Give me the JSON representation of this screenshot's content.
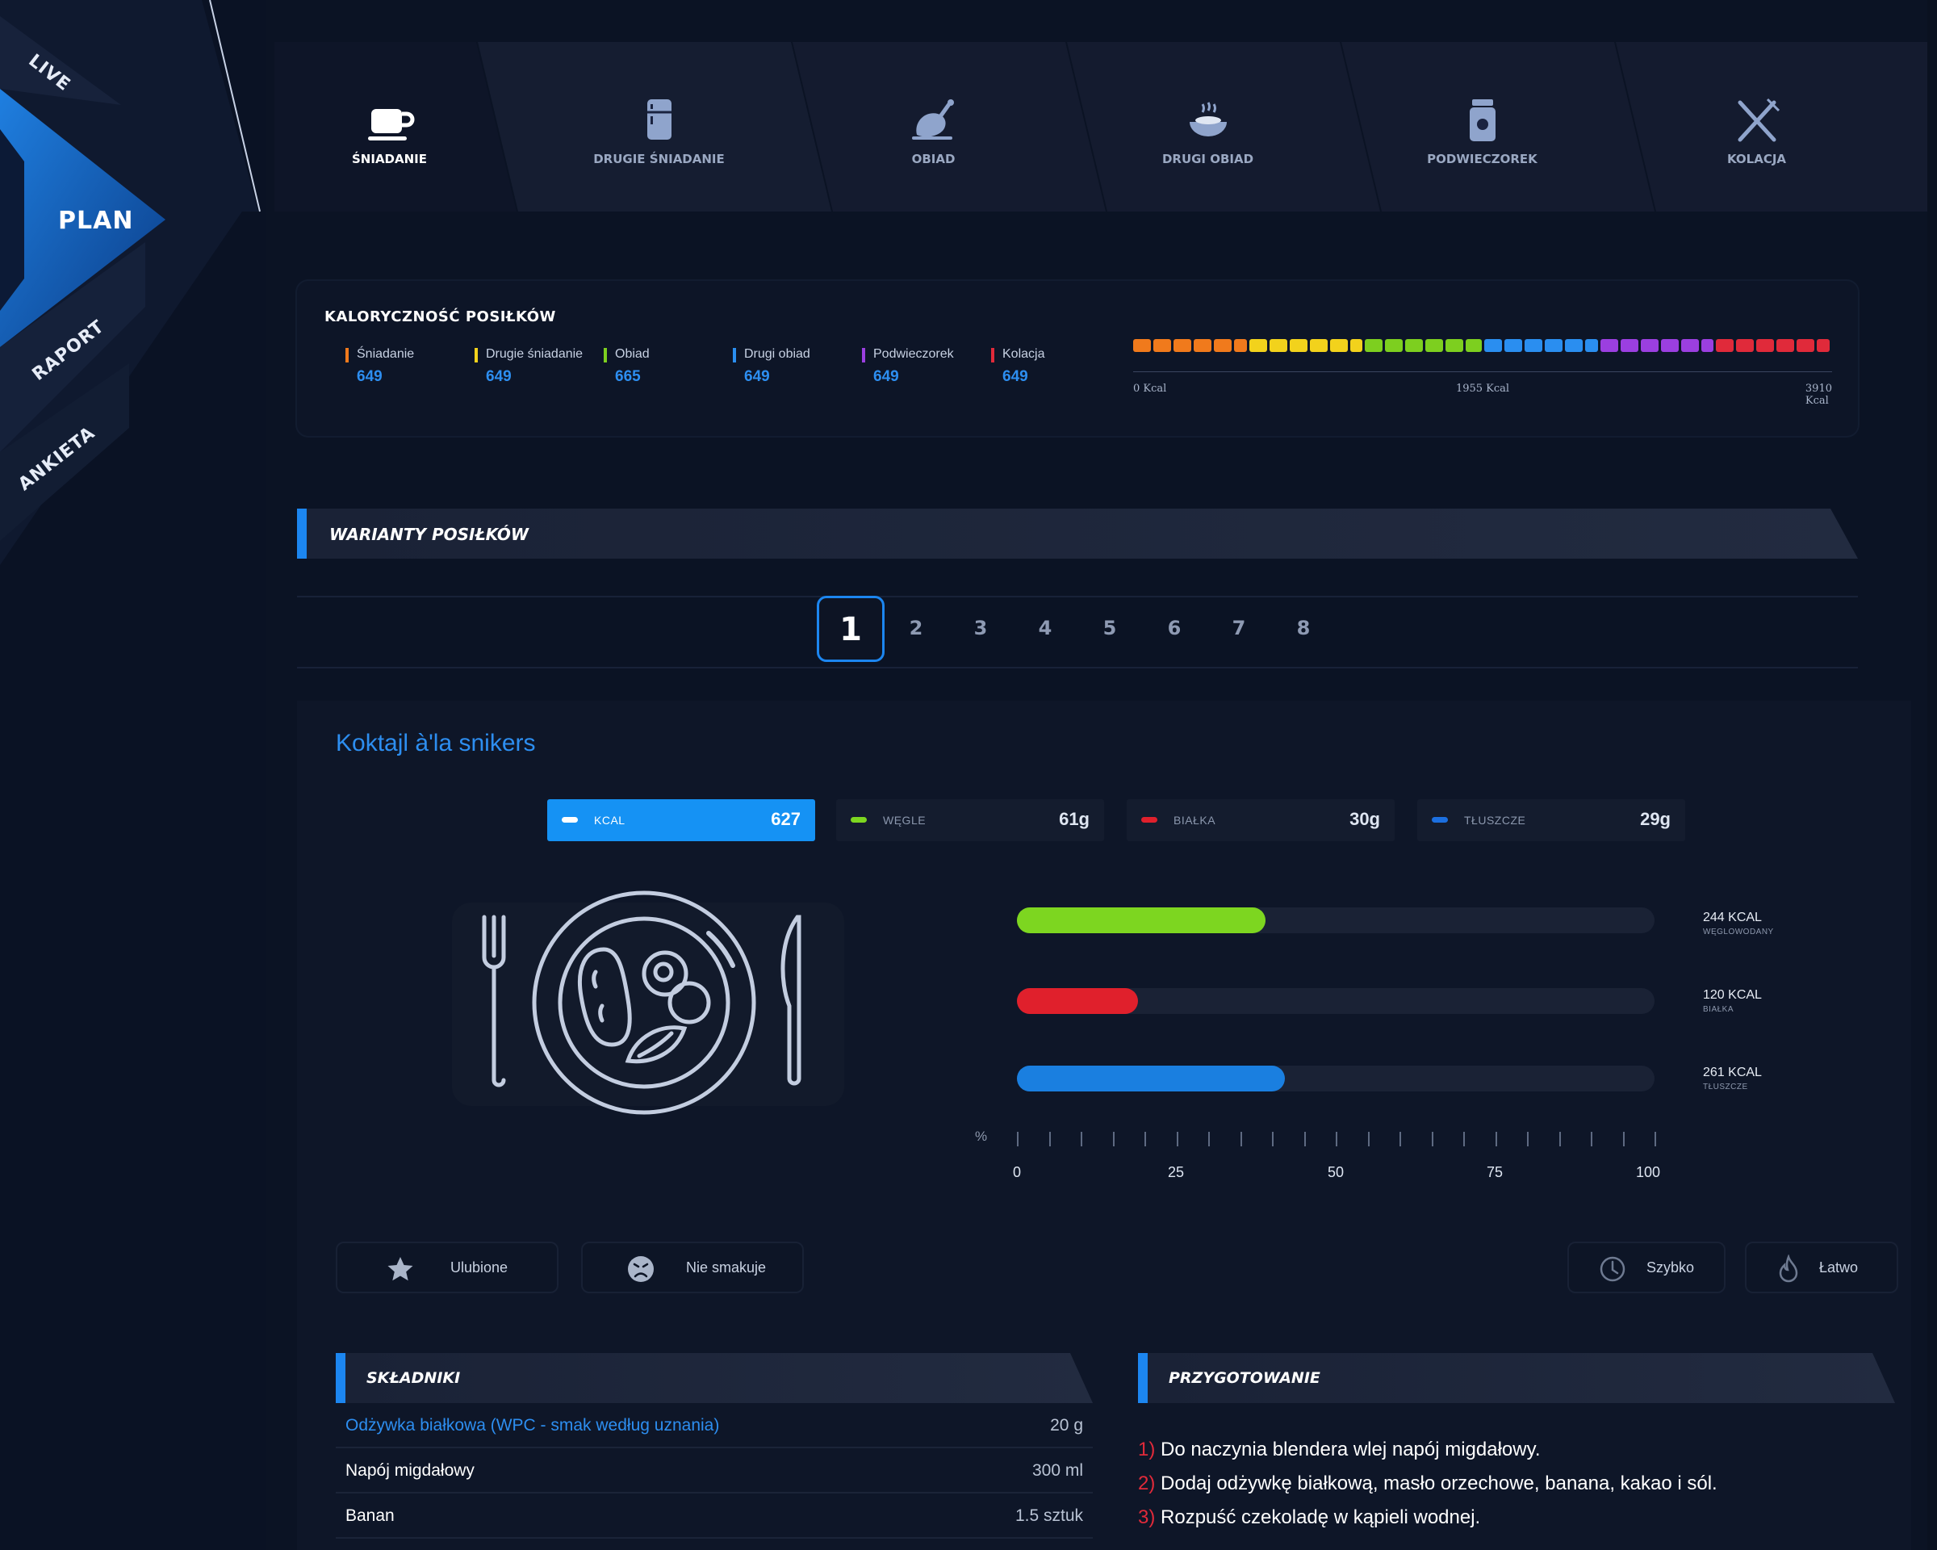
{
  "sidenav": {
    "items": [
      {
        "label": "LIVE"
      },
      {
        "label": "PLAN"
      },
      {
        "label": "RAPORT"
      },
      {
        "label": "ANKIETA"
      }
    ]
  },
  "tabs": [
    {
      "label": "ŚNIADANIE",
      "icon": "coffee-cup-icon",
      "active": true
    },
    {
      "label": "DRUGIE ŚNIADANIE",
      "icon": "fridge-icon",
      "active": false
    },
    {
      "label": "OBIAD",
      "icon": "chicken-leg-icon",
      "active": false
    },
    {
      "label": "DRUGI OBIAD",
      "icon": "hot-dish-icon",
      "active": false
    },
    {
      "label": "PODWIECZOREK",
      "icon": "jar-icon",
      "active": false
    },
    {
      "label": "KOLACJA",
      "icon": "fork-knife-icon",
      "active": false
    }
  ],
  "calories": {
    "title": "KALORYCZNOŚĆ POSIŁKÓW",
    "meals": [
      {
        "name": "Śniadanie",
        "value": "649",
        "color": "#f07a1c"
      },
      {
        "name": "Drugie śniadanie",
        "value": "649",
        "color": "#f2d21c"
      },
      {
        "name": "Obiad",
        "value": "665",
        "color": "#7dcf1f"
      },
      {
        "name": "Drugi obiad",
        "value": "649",
        "color": "#2a8ef0"
      },
      {
        "name": "Podwieczorek",
        "value": "649",
        "color": "#9b3fe0"
      },
      {
        "name": "Kolacja",
        "value": "649",
        "color": "#e02a3a"
      }
    ],
    "axis": {
      "min": "0 Kcal",
      "mid": "1955 Kcal",
      "max": "3910 Kcal"
    }
  },
  "variants": {
    "title": "WARIANTY POSIŁKÓW",
    "pages": [
      "1",
      "2",
      "3",
      "4",
      "5",
      "6",
      "7",
      "8"
    ],
    "active_page": "1"
  },
  "recipe": {
    "title": "Koktajl à'la snikers",
    "macros": [
      {
        "name": "KCAL",
        "value": "627",
        "color": "#ffffff",
        "active": true
      },
      {
        "name": "WĘGLE",
        "value": "61g",
        "color": "#7dd620",
        "active": false
      },
      {
        "name": "BIAŁKA",
        "value": "30g",
        "color": "#e0202c",
        "active": false
      },
      {
        "name": "TŁUSZCZE",
        "value": "29g",
        "color": "#1c6fe0",
        "active": false
      }
    ],
    "breakdown": [
      {
        "value": "244 KCAL",
        "sub": "WĘGLOWODANY",
        "percent": 39,
        "color": "#7dd620"
      },
      {
        "value": "120 KCAL",
        "sub": "BIAŁKA",
        "percent": 19,
        "color": "#e0202c"
      },
      {
        "value": "261 KCAL",
        "sub": "TŁUSZCZE",
        "percent": 42,
        "color": "#1a7fe0"
      }
    ],
    "scale": {
      "unit": "%",
      "labels": [
        "0",
        "25",
        "50",
        "75",
        "100"
      ]
    },
    "actions": [
      {
        "label": "Ulubione",
        "icon": "star-icon"
      },
      {
        "label": "Nie smakuje",
        "icon": "dislike-face-icon"
      },
      {
        "label": "Szybko",
        "icon": "clock-icon"
      },
      {
        "label": "Łatwo",
        "icon": "flame-icon"
      }
    ],
    "ingredients_title": "SKŁADNIKI",
    "ingredients": [
      {
        "name": "Odżywka białkowa (WPC - smak według uznania)",
        "qty": "20 g",
        "link": true
      },
      {
        "name": "Napój migdałowy",
        "qty": "300 ml",
        "link": false
      },
      {
        "name": "Banan",
        "qty": "1.5 sztuk",
        "link": false
      }
    ],
    "preparation_title": "PRZYGOTOWANIE",
    "steps": [
      {
        "num": "1)",
        "text": "Do naczynia blendera wlej napój migdałowy."
      },
      {
        "num": "2)",
        "text": "Dodaj odżywkę białkową, masło orzechowe, banana, kakao i sól."
      },
      {
        "num": "3)",
        "text": "Rozpuść czekoladę w kąpieli wodnej."
      }
    ]
  }
}
